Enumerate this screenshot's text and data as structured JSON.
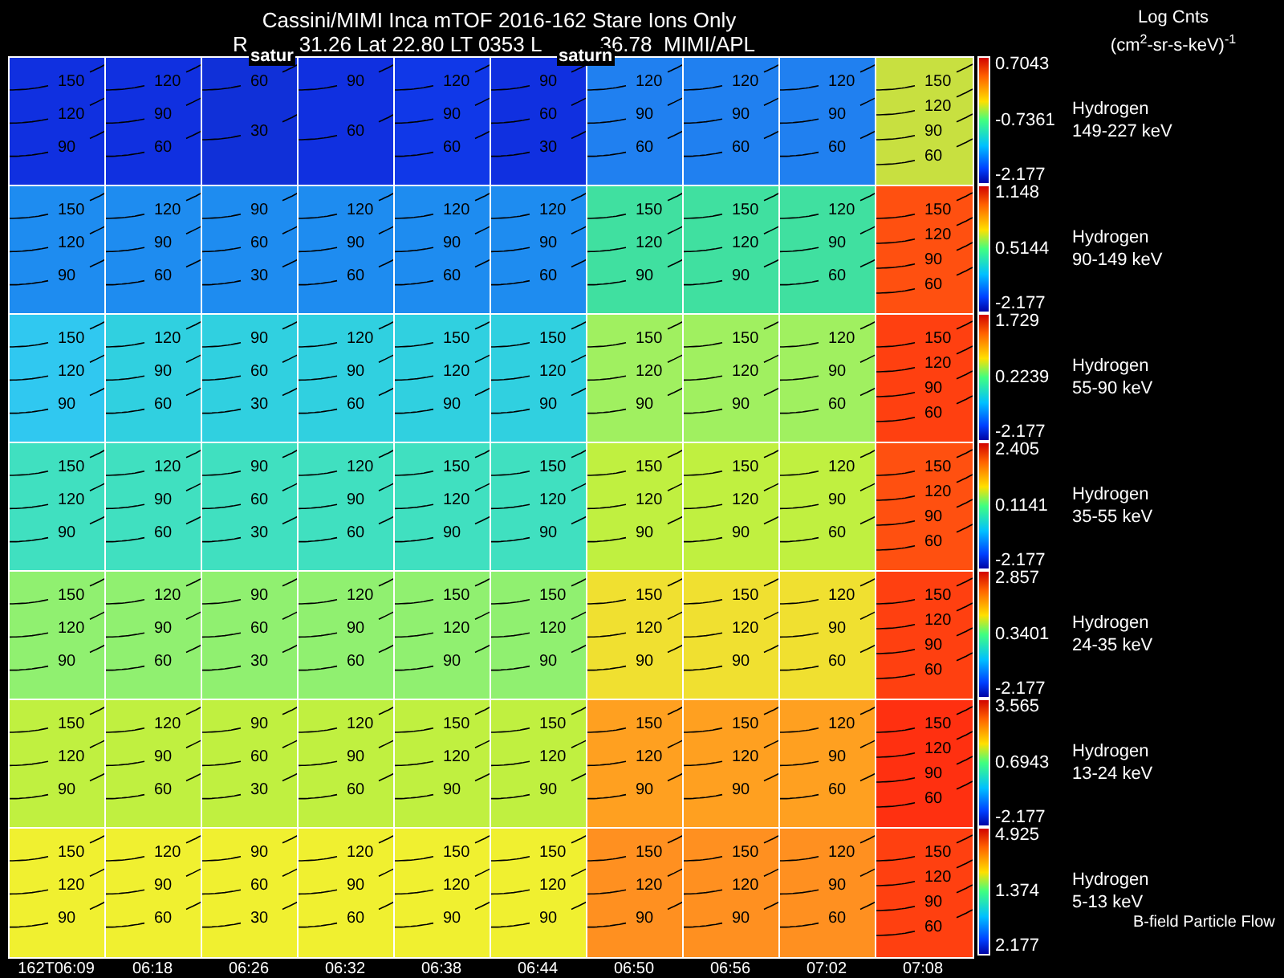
{
  "header": {
    "title": "Cassini/MIMI Inca mTOF  2016-162   Stare   Ions Only",
    "info": [
      "R",
      "31.26 Lat 22.80 LT 0353 L",
      "36.78  MIMI/APL"
    ],
    "units_title": "Log Cnts",
    "units": "(cm$^{2}$-sr-s-keV)$^{-1}$",
    "markers": [
      "satur",
      "saturn"
    ]
  },
  "rows": [
    {
      "species": "Hydrogen",
      "energy": "149-227 keV",
      "scale": {
        "max": "0.7043",
        "mid": "-0.7361",
        "min": "-2.177"
      },
      "panels": [
        {
          "color": "#1030e0",
          "contours": [
            "150",
            "120",
            "90"
          ]
        },
        {
          "color": "#1030e0",
          "contours": [
            "120",
            "90",
            "60"
          ]
        },
        {
          "color": "#1030d8",
          "contours": [
            "60",
            "30"
          ]
        },
        {
          "color": "#1030e0",
          "contours": [
            "90",
            "60"
          ]
        },
        {
          "color": "#1038e8",
          "contours": [
            "120",
            "90",
            "60"
          ]
        },
        {
          "color": "#1030e0",
          "contours": [
            "90",
            "60",
            "30"
          ]
        },
        {
          "color": "#2080f0",
          "contours": [
            "120",
            "90",
            "60"
          ]
        },
        {
          "color": "#2080f0",
          "contours": [
            "120",
            "90",
            "60"
          ]
        },
        {
          "color": "#2080f0",
          "contours": [
            "120",
            "90",
            "60"
          ]
        },
        {
          "color": "#c8e040",
          "contours": [
            "150",
            "120",
            "90",
            "60"
          ]
        }
      ]
    },
    {
      "species": "Hydrogen",
      "energy": "90-149 keV",
      "scale": {
        "max": "1.148",
        "mid": "0.5144",
        "min": "-2.177"
      },
      "panels": [
        {
          "color": "#1e8cf0",
          "contours": [
            "150",
            "120",
            "90"
          ]
        },
        {
          "color": "#1e8cf0",
          "contours": [
            "120",
            "90",
            "60"
          ]
        },
        {
          "color": "#1e8cf0",
          "contours": [
            "90",
            "60",
            "30"
          ]
        },
        {
          "color": "#1e8cf0",
          "contours": [
            "120",
            "90",
            "60"
          ]
        },
        {
          "color": "#1e8cf0",
          "contours": [
            "120",
            "90",
            "60"
          ]
        },
        {
          "color": "#1e8cf0",
          "contours": [
            "120",
            "90",
            "60"
          ]
        },
        {
          "color": "#40e0a0",
          "contours": [
            "150",
            "120",
            "90"
          ]
        },
        {
          "color": "#40e0a0",
          "contours": [
            "150",
            "120",
            "90"
          ]
        },
        {
          "color": "#40e0a0",
          "contours": [
            "120",
            "90",
            "60"
          ]
        },
        {
          "color": "#ff5010",
          "contours": [
            "150",
            "120",
            "90",
            "60"
          ]
        }
      ]
    },
    {
      "species": "Hydrogen",
      "energy": "55-90 keV",
      "scale": {
        "max": "1.729",
        "mid": "0.2239",
        "min": "-2.177"
      },
      "panels": [
        {
          "color": "#30c8f0",
          "contours": [
            "150",
            "120",
            "90"
          ]
        },
        {
          "color": "#30d0e0",
          "contours": [
            "120",
            "90",
            "60"
          ]
        },
        {
          "color": "#30d0e0",
          "contours": [
            "90",
            "60",
            "30"
          ]
        },
        {
          "color": "#30d0e0",
          "contours": [
            "120",
            "90",
            "60"
          ]
        },
        {
          "color": "#30d0e0",
          "contours": [
            "150",
            "120",
            "90"
          ]
        },
        {
          "color": "#30d0e0",
          "contours": [
            "150",
            "120",
            "90"
          ]
        },
        {
          "color": "#a0f060",
          "contours": [
            "150",
            "120",
            "90"
          ]
        },
        {
          "color": "#a0f060",
          "contours": [
            "150",
            "120",
            "90"
          ]
        },
        {
          "color": "#a0f060",
          "contours": [
            "120",
            "90",
            "60"
          ]
        },
        {
          "color": "#ff4010",
          "contours": [
            "150",
            "120",
            "90",
            "60"
          ]
        }
      ]
    },
    {
      "species": "Hydrogen",
      "energy": "35-55 keV",
      "scale": {
        "max": "2.405",
        "mid": "0.1141",
        "min": "-2.177"
      },
      "panels": [
        {
          "color": "#40e0c0",
          "contours": [
            "150",
            "120",
            "90"
          ]
        },
        {
          "color": "#40e0c0",
          "contours": [
            "120",
            "90",
            "60"
          ]
        },
        {
          "color": "#40e0c0",
          "contours": [
            "90",
            "60",
            "30"
          ]
        },
        {
          "color": "#40e0c0",
          "contours": [
            "120",
            "90",
            "60"
          ]
        },
        {
          "color": "#40e0c0",
          "contours": [
            "150",
            "120",
            "90"
          ]
        },
        {
          "color": "#40e0c0",
          "contours": [
            "150",
            "120",
            "90"
          ]
        },
        {
          "color": "#c0f040",
          "contours": [
            "150",
            "120",
            "90"
          ]
        },
        {
          "color": "#c0f040",
          "contours": [
            "150",
            "120",
            "90"
          ]
        },
        {
          "color": "#c0f040",
          "contours": [
            "120",
            "90",
            "60"
          ]
        },
        {
          "color": "#ff5010",
          "contours": [
            "150",
            "120",
            "90",
            "60"
          ]
        }
      ]
    },
    {
      "species": "Hydrogen",
      "energy": "24-35 keV",
      "scale": {
        "max": "2.857",
        "mid": "0.3401",
        "min": "-2.177"
      },
      "panels": [
        {
          "color": "#90f070",
          "contours": [
            "150",
            "120",
            "90"
          ]
        },
        {
          "color": "#90f070",
          "contours": [
            "120",
            "90",
            "60"
          ]
        },
        {
          "color": "#90f070",
          "contours": [
            "90",
            "60",
            "30"
          ]
        },
        {
          "color": "#90f070",
          "contours": [
            "120",
            "90",
            "60"
          ]
        },
        {
          "color": "#90f070",
          "contours": [
            "150",
            "120",
            "90"
          ]
        },
        {
          "color": "#90f070",
          "contours": [
            "150",
            "120",
            "90"
          ]
        },
        {
          "color": "#f0e030",
          "contours": [
            "150",
            "120",
            "90"
          ]
        },
        {
          "color": "#f0e030",
          "contours": [
            "150",
            "120",
            "90"
          ]
        },
        {
          "color": "#f0e030",
          "contours": [
            "120",
            "90",
            "60"
          ]
        },
        {
          "color": "#ff4010",
          "contours": [
            "150",
            "120",
            "90",
            "60"
          ]
        }
      ]
    },
    {
      "species": "Hydrogen",
      "energy": "13-24 keV",
      "scale": {
        "max": "3.565",
        "mid": "0.6943",
        "min": "-2.177"
      },
      "panels": [
        {
          "color": "#c0f040",
          "contours": [
            "150",
            "120",
            "90"
          ]
        },
        {
          "color": "#c0f040",
          "contours": [
            "120",
            "90",
            "60"
          ]
        },
        {
          "color": "#c0f040",
          "contours": [
            "90",
            "60",
            "30"
          ]
        },
        {
          "color": "#c0f040",
          "contours": [
            "120",
            "90",
            "60"
          ]
        },
        {
          "color": "#c0f040",
          "contours": [
            "150",
            "120",
            "90"
          ]
        },
        {
          "color": "#c0f040",
          "contours": [
            "150",
            "120",
            "90"
          ]
        },
        {
          "color": "#ffa020",
          "contours": [
            "150",
            "120",
            "90"
          ]
        },
        {
          "color": "#ffa020",
          "contours": [
            "150",
            "120",
            "90"
          ]
        },
        {
          "color": "#ffa020",
          "contours": [
            "120",
            "90",
            "60"
          ]
        },
        {
          "color": "#ff3010",
          "contours": [
            "150",
            "120",
            "90",
            "60"
          ]
        }
      ]
    },
    {
      "species": "Hydrogen",
      "energy": "5-13 keV",
      "scale": {
        "max": "4.925",
        "mid": "1.374",
        "min": "2.177"
      },
      "panels": [
        {
          "color": "#f0f030",
          "contours": [
            "150",
            "120",
            "90"
          ]
        },
        {
          "color": "#f0f030",
          "contours": [
            "120",
            "90",
            "60"
          ]
        },
        {
          "color": "#f0f030",
          "contours": [
            "90",
            "60",
            "30"
          ]
        },
        {
          "color": "#f0f030",
          "contours": [
            "120",
            "90",
            "60"
          ]
        },
        {
          "color": "#f0f030",
          "contours": [
            "150",
            "120",
            "90"
          ]
        },
        {
          "color": "#f0f030",
          "contours": [
            "150",
            "120",
            "90"
          ]
        },
        {
          "color": "#ff9020",
          "contours": [
            "150",
            "120",
            "90"
          ]
        },
        {
          "color": "#ff9020",
          "contours": [
            "150",
            "120",
            "90"
          ]
        },
        {
          "color": "#ff9020",
          "contours": [
            "120",
            "90",
            "60"
          ]
        },
        {
          "color": "#ff4010",
          "contours": [
            "150",
            "120",
            "90",
            "60"
          ]
        }
      ]
    }
  ],
  "legend_note": "B-field Particle Flow",
  "times": [
    "162T06:09",
    "06:18",
    "06:26",
    "06:32",
    "06:38",
    "06:44",
    "06:50",
    "06:56",
    "07:02",
    "07:08"
  ]
}
